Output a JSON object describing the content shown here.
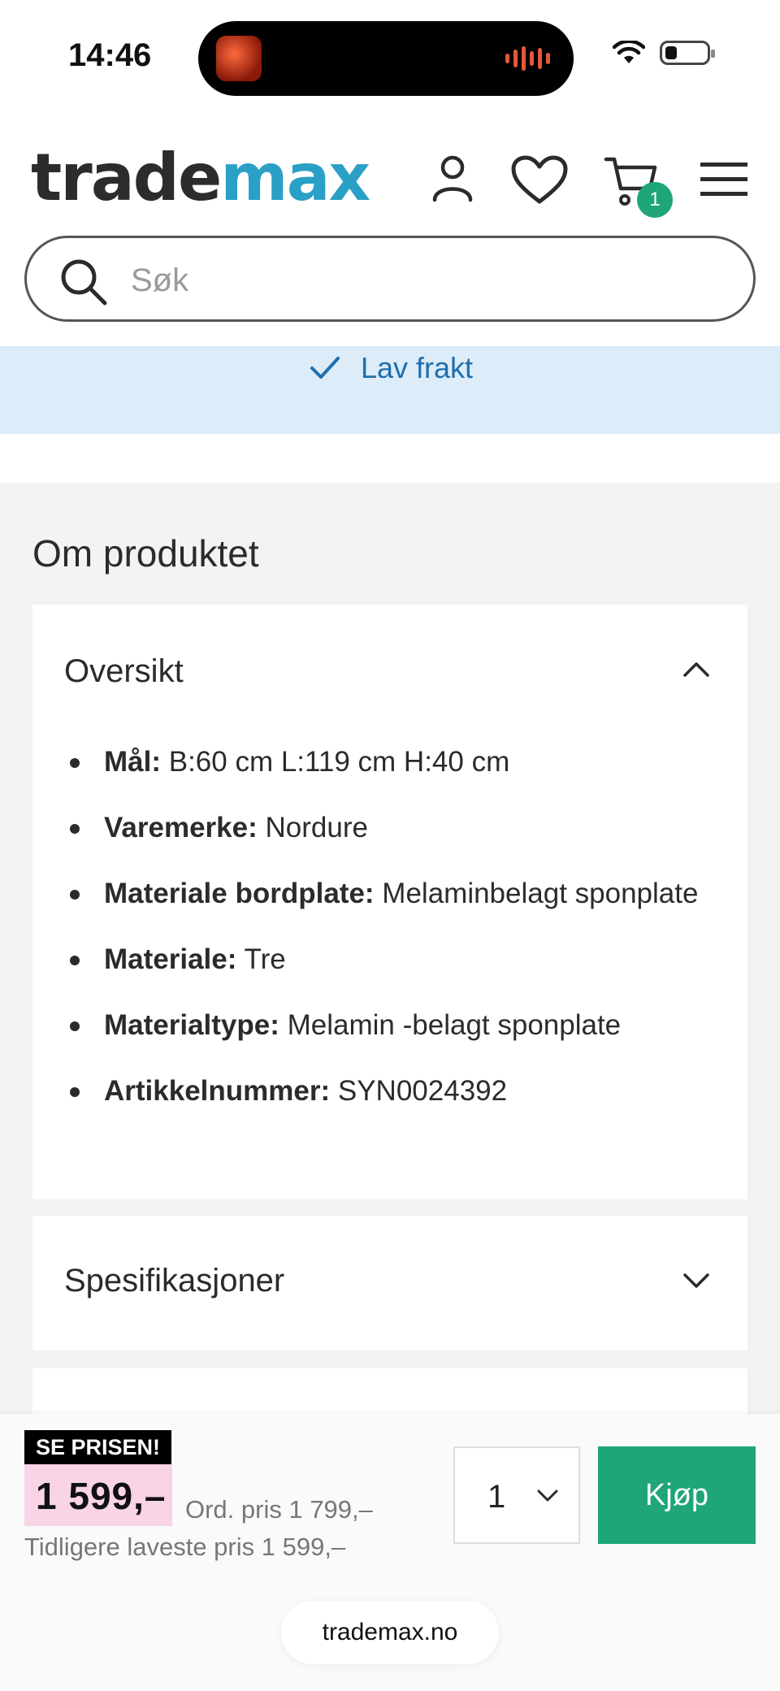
{
  "status_bar": {
    "time": "14:46"
  },
  "header": {
    "logo_part1": "trade",
    "logo_part2": "max",
    "cart_count": "1",
    "search": {
      "placeholder": "Søk",
      "value": ""
    }
  },
  "banner": {
    "text": "Lav frakt"
  },
  "main": {
    "section_title": "Om produktet",
    "overview": {
      "title": "Oversikt",
      "items": [
        {
          "label": "Mål:",
          "value": " B:60 cm L:119 cm H:40 cm"
        },
        {
          "label": "Varemerke:",
          "value": " Nordure"
        },
        {
          "label": "Materiale bordplate:",
          "value": " Melaminbelagt sponplate"
        },
        {
          "label": "Materiale:",
          "value": " Tre"
        },
        {
          "label": "Materialtype:",
          "value": " Melamin -belagt sponplate"
        },
        {
          "label": "Artikkelnummer:",
          "value": " SYN0024392"
        }
      ]
    },
    "specs": {
      "title": "Spesifikasjoner"
    }
  },
  "buy_bar": {
    "promo_tag": "SE PRISEN!",
    "price": "1 599,–",
    "ord_price": "Ord. pris 1 799,–",
    "previous_lowest": "Tidligere laveste pris 1 599,–",
    "quantity": "1",
    "buy_label": "Kjøp"
  },
  "browser": {
    "url": "trademax.no"
  },
  "colors": {
    "brand_teal": "#2aa0c6",
    "buy_green": "#1ea57a",
    "banner_blue": "#dcecf9",
    "price_pink": "#f9d3e6"
  }
}
